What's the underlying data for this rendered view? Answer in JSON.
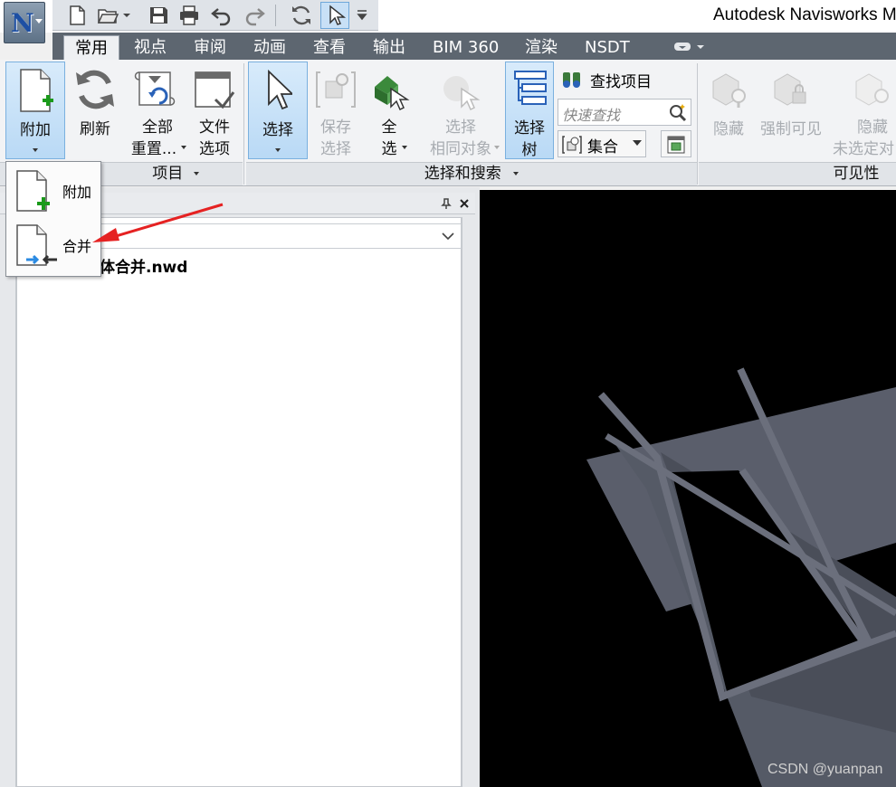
{
  "window": {
    "title": "Autodesk Navisworks M"
  },
  "app_button": {
    "letter": "N"
  },
  "quick_access": [
    "new-icon",
    "open-icon",
    "save-icon",
    "print-icon",
    "undo-icon",
    "redo-icon",
    "refresh-icon",
    "select-icon"
  ],
  "tabs": [
    "常用",
    "视点",
    "审阅",
    "动画",
    "查看",
    "输出",
    "BIM 360",
    "渲染",
    "NSDT"
  ],
  "active_tab": "常用",
  "ribbon": {
    "project": {
      "append": "附加",
      "refresh": "刷新",
      "reset_all_l1": "全部",
      "reset_all_l2": "重置...",
      "file_options_l1": "文件",
      "file_options_l2": "选项",
      "panel_label": "项目"
    },
    "select_search": {
      "select": "选择",
      "save_selection_l1": "保存",
      "save_selection_l2": "选择",
      "select_all_l1": "全",
      "select_all_l2": "选",
      "select_same_l1": "选择",
      "select_same_l2": "相同对象",
      "selection_tree_l1": "选择",
      "selection_tree_l2": "树",
      "find_items": "查找项目",
      "quick_find_placeholder": "快速查找",
      "sets": "集合",
      "panel_label": "选择和搜索"
    },
    "visibility": {
      "hide": "隐藏",
      "require": "强制可见",
      "hide_unselected_l1": "隐藏",
      "hide_unselected_l2": "未选定对",
      "panel_label": "可见性"
    }
  },
  "dropdown": {
    "items": [
      "附加",
      "合并"
    ]
  },
  "selection_tree": {
    "file": "体合并.nwd"
  },
  "watermark": "CSDN @yuanpan",
  "colors": {
    "tab_bar": "#5d6670",
    "viewport_bg": "#000000",
    "model_fill": "#5a5e6b",
    "accent": "#e52222"
  }
}
